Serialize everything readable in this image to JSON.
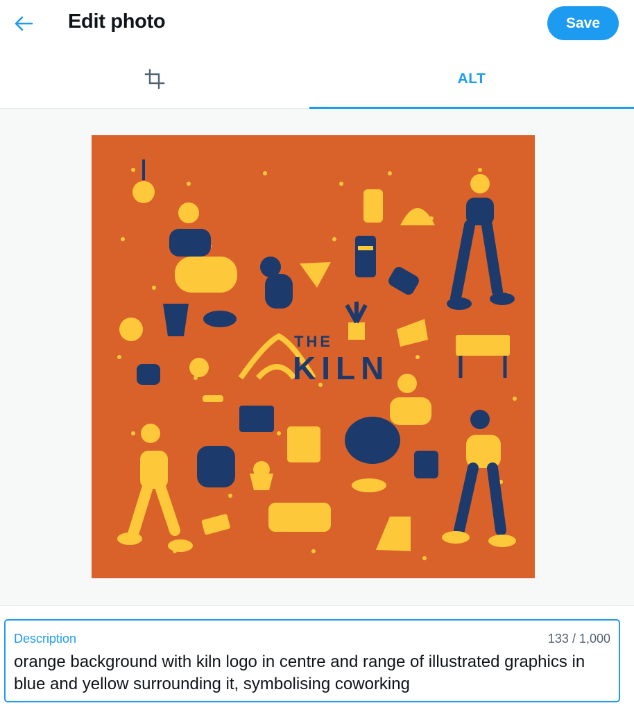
{
  "header": {
    "title": "Edit photo",
    "save_label": "Save",
    "back_icon": "arrow-left-icon"
  },
  "tabs": {
    "crop_icon": "crop-icon",
    "alt_label": "ALT"
  },
  "image": {
    "logo_line1": "THE",
    "logo_line2": "KILN",
    "background_color": "#d9622b",
    "accent_yellow": "#fdc83a",
    "accent_blue": "#1c3b6c"
  },
  "description": {
    "label": "Description",
    "count": "133 / 1,000",
    "value": "orange background with kiln logo in centre and range of illustrated graphics in blue and yellow surrounding it, symbolising coworking"
  },
  "colors": {
    "accent": "#1d9bf0"
  }
}
